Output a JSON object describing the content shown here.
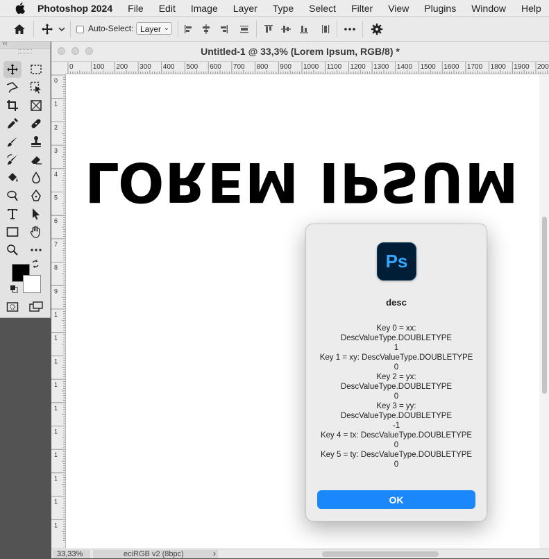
{
  "menubar": {
    "app_name": "Photoshop 2024",
    "items": [
      "File",
      "Edit",
      "Image",
      "Layer",
      "Type",
      "Select",
      "Filter",
      "View",
      "Plugins",
      "Window",
      "Help"
    ]
  },
  "options_bar": {
    "auto_select_label": "Auto-Select:",
    "auto_select_checked": false,
    "layer_select_value": "Layer",
    "icons": [
      "home-icon",
      "move-tool-icon",
      "align-left-edges-icon",
      "align-horizontal-centers-icon",
      "align-right-edges-icon",
      "distribute-icon",
      "align-top-edges-icon",
      "align-vertical-centers-icon",
      "align-bottom-edges-icon",
      "distribute-vertical-icon",
      "more-options-icon",
      "settings-gear-icon"
    ]
  },
  "tools": [
    "move-tool",
    "rectangular-marquee-tool",
    "lasso-tool",
    "object-selection-tool",
    "crop-tool",
    "frame-tool",
    "eyedropper-tool",
    "spot-healing-brush-tool",
    "brush-tool",
    "clone-stamp-tool",
    "history-brush-tool",
    "eraser-tool",
    "paint-bucket-tool",
    "blur-tool",
    "dodge-tool",
    "pen-tool",
    "type-tool",
    "path-selection-tool",
    "rectangle-tool",
    "hand-tool",
    "zoom-tool",
    "more-tools"
  ],
  "document": {
    "title": "Untitled-1 @ 33,3% (Lorem Ipsum, RGB/8) *",
    "canvas_text": "LOREM IPSUM",
    "ruler_h_ticks": [
      "0",
      "100",
      "200",
      "300",
      "400",
      "500",
      "600",
      "700",
      "800",
      "900",
      "1000",
      "1100",
      "1200",
      "1300",
      "1400",
      "1500",
      "1600",
      "1700",
      "1800",
      "1900",
      "200"
    ],
    "ruler_v_ticks": [
      "0",
      "1",
      "2",
      "3",
      "4",
      "5",
      "6",
      "7",
      "8",
      "9",
      "1",
      "1",
      "1",
      "1",
      "1",
      "1",
      "1",
      "1",
      "1",
      "1"
    ],
    "zoom": "33,33%",
    "color_profile": "eciRGB v2 (8bpc)"
  },
  "colors": {
    "foreground": "#000000",
    "background": "#ffffff",
    "ok_button": "#1a87fb",
    "ps_icon_bg": "#001e36",
    "ps_icon_fg": "#31a8ff"
  },
  "dialog": {
    "icon_label": "Ps",
    "title": "desc",
    "message_lines": [
      "Key 0 = xx:",
      "DescValueType.DOUBLETYPE",
      "1",
      "Key 1 = xy: DescValueType.DOUBLETYPE",
      "0",
      "Key 2 = yx:",
      "DescValueType.DOUBLETYPE",
      "0",
      "Key 3 = yy:",
      "DescValueType.DOUBLETYPE",
      "-1",
      "Key 4 = tx: DescValueType.DOUBLETYPE",
      "0",
      "Key 5 = ty: DescValueType.DOUBLETYPE",
      "0"
    ],
    "ok_label": "OK"
  }
}
